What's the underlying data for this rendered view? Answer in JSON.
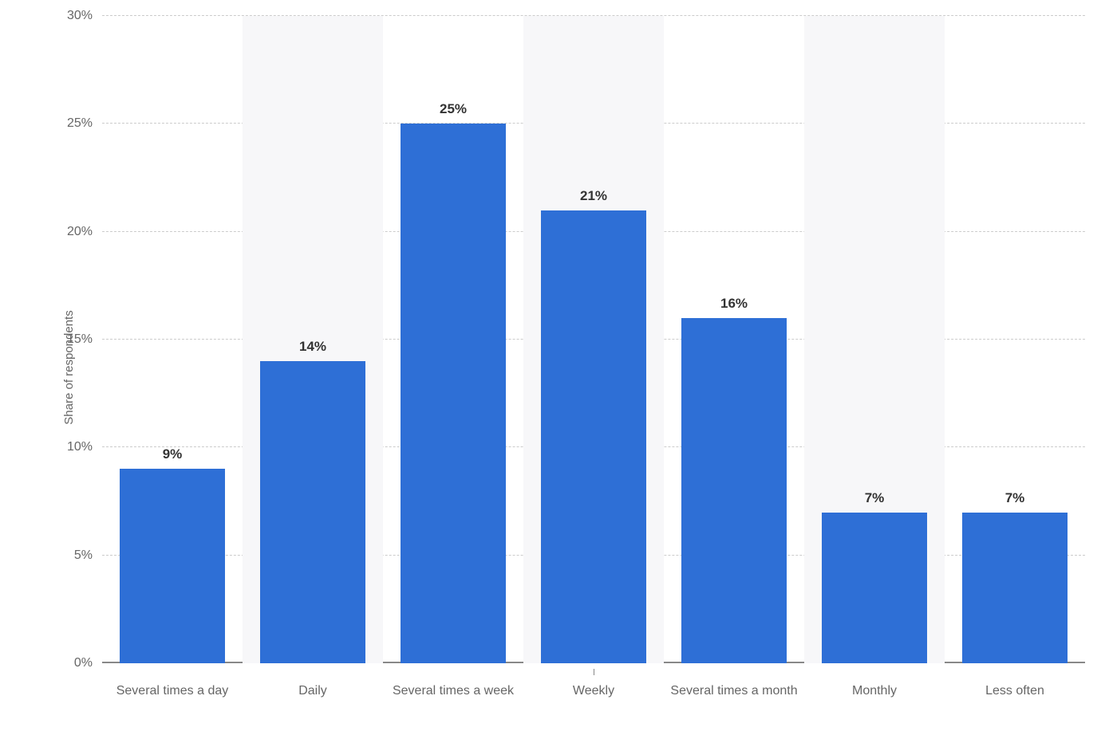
{
  "chart_data": {
    "type": "bar",
    "categories": [
      "Several times a day",
      "Daily",
      "Several times a week",
      "Weekly",
      "Several times a month",
      "Monthly",
      "Less often"
    ],
    "values": [
      9,
      14,
      25,
      21,
      16,
      7,
      7
    ],
    "value_labels": [
      "9%",
      "14%",
      "25%",
      "21%",
      "16%",
      "7%",
      "7%"
    ],
    "ylabel": "Share of respondents",
    "xlabel": "",
    "title": "",
    "ylim": [
      0,
      30
    ],
    "y_ticks": [
      0,
      5,
      10,
      15,
      20,
      25,
      30
    ],
    "y_tick_labels": [
      "0%",
      "5%",
      "10%",
      "15%",
      "20%",
      "25%",
      "30%"
    ],
    "bar_color": "#2e6fd6"
  }
}
